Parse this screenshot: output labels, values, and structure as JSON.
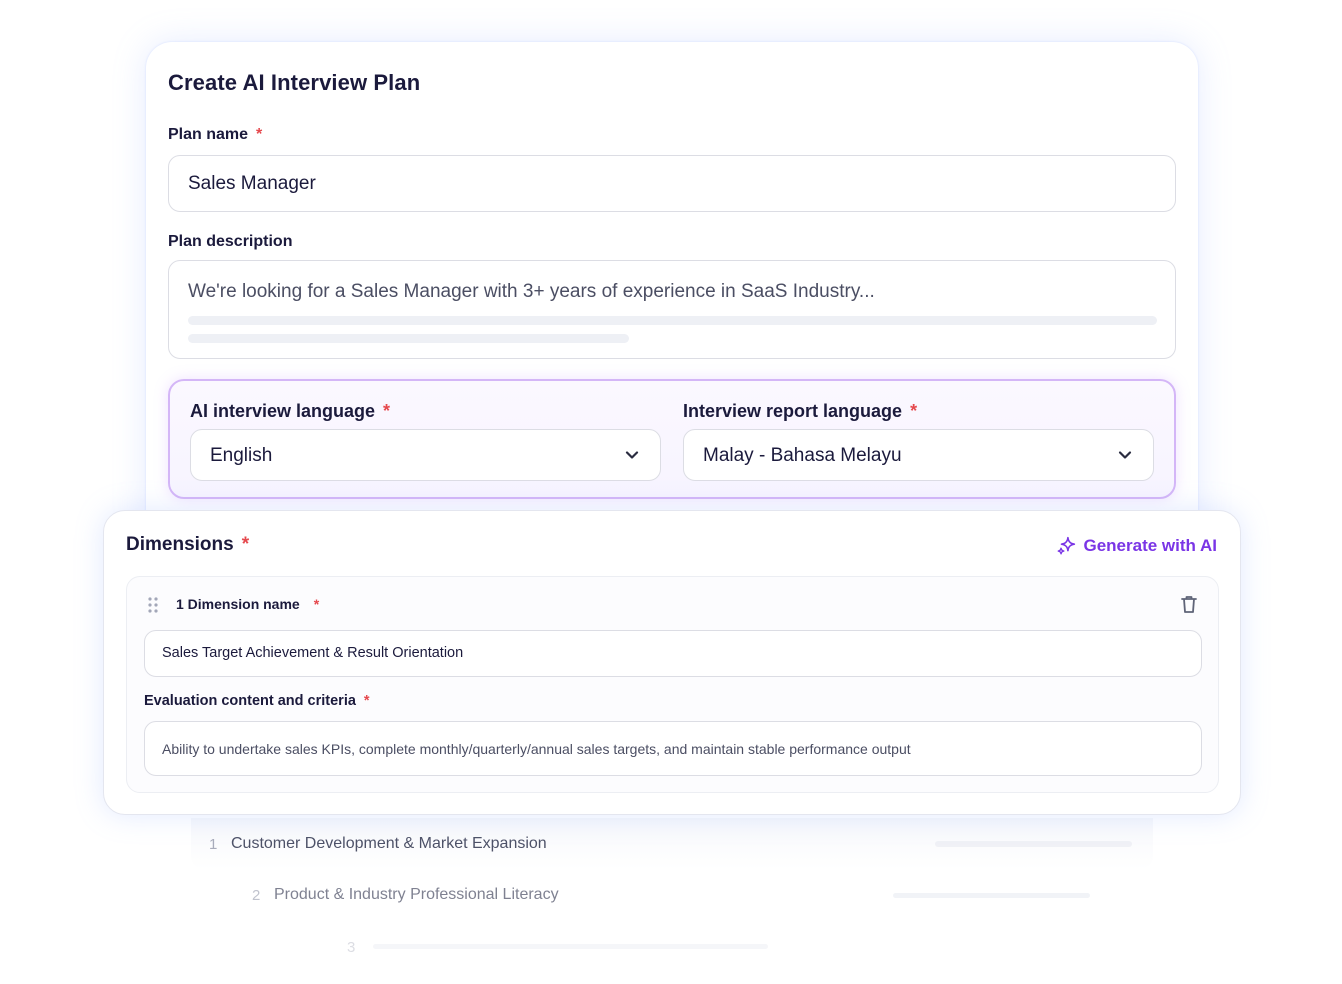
{
  "plan": {
    "title": "Create AI Interview Plan",
    "name_label": "Plan name",
    "name_value": "Sales Manager",
    "description_label": "Plan description",
    "description_value": "We're looking for a Sales Manager with 3+ years of experience in SaaS Industry...",
    "required_mark": "*"
  },
  "languages": {
    "ai_label": "AI interview language",
    "ai_value": "English",
    "report_label": "Interview report language",
    "report_value": "Malay - Bahasa Melayu"
  },
  "dimensions": {
    "title": "Dimensions",
    "generate_label": "Generate with AI",
    "item": {
      "name_label": "1 Dimension name",
      "name_value": "Sales Target Achievement & Result Orientation",
      "criteria_label": "Evaluation content and criteria",
      "criteria_value": "Ability to undertake sales KPIs, complete monthly/quarterly/annual sales targets, and maintain stable performance output"
    },
    "list": [
      {
        "num": "1",
        "label": "Customer Development & Market Expansion"
      },
      {
        "num": "2",
        "label": "Product & Industry Professional Literacy"
      },
      {
        "num": "3",
        "label": ""
      }
    ]
  },
  "colors": {
    "accent": "#7a35e6",
    "required": "#e5484d",
    "panel_border": "#d4b6f7"
  }
}
